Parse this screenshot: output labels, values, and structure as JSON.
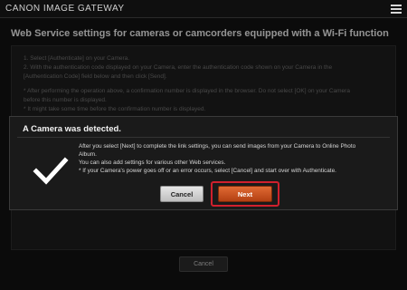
{
  "header": {
    "logo": "CANON IMAGE GATEWAY",
    "menu_icon": "hamburger-menu-icon"
  },
  "page": {
    "title": "Web Service settings for cameras or camcorders equipped with a Wi-Fi function",
    "instructions": [
      "1. Select [Authenticate] on your Camera.",
      "2. With the authentication code displayed on your Camera, enter the authentication code shown on your Camera in the",
      "[Authentication Code] field below and then click [Send].",
      "* After performing the operation above, a confirmation number is displayed in the browser. Do not select [OK] on your Camera",
      "before this number is displayed.",
      "* It might take some time before the confirmation number is displayed."
    ],
    "cancel_label": "Cancel"
  },
  "modal": {
    "title": "A Camera was detected.",
    "icon": "checkmark-icon",
    "lines": [
      "After you select [Next] to complete the link settings, you can send images from your Camera to Online Photo",
      "Album.",
      "You can also add settings for various other Web services.",
      "* If your Camera's power goes off or an error occurs, select [Cancel] and start over with Authenticate."
    ],
    "cancel_label": "Cancel",
    "next_label": "Next"
  },
  "colors": {
    "accent": "#c4521f",
    "highlight": "#d0202d"
  }
}
